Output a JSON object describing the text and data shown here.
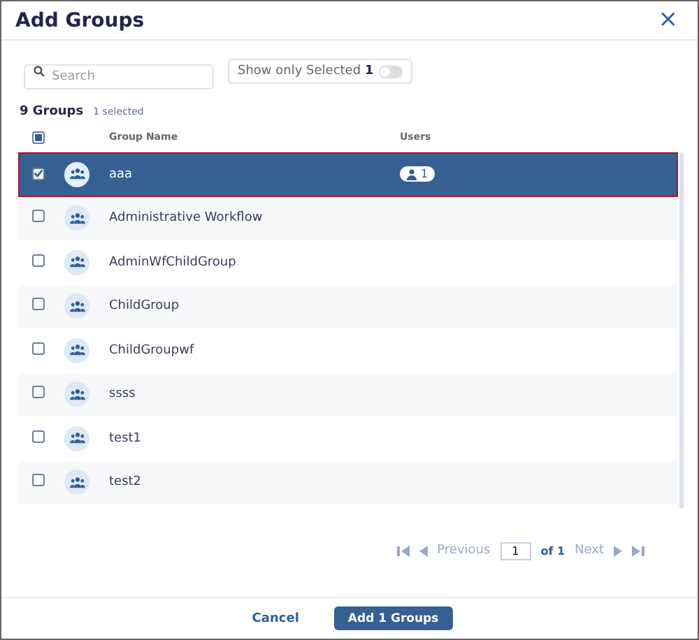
{
  "dialog": {
    "title": "Add Groups",
    "close": "×"
  },
  "search": {
    "placeholder": "Search"
  },
  "show_only_selected": {
    "label": "Show only Selected",
    "count": "1",
    "on": false
  },
  "summary": {
    "count": "9 Groups",
    "selected": "1 selected"
  },
  "table": {
    "select_all_indeterminate": true,
    "columns": [
      "Group Name",
      "Users"
    ],
    "rows": [
      {
        "name": "aaa",
        "selected": true,
        "users": "1"
      },
      {
        "name": "Administrative Workflow",
        "selected": false
      },
      {
        "name": "AdminWfChildGroup",
        "selected": false
      },
      {
        "name": "ChildGroup",
        "selected": false
      },
      {
        "name": "ChildGroupwf",
        "selected": false
      },
      {
        "name": "ssss",
        "selected": false
      },
      {
        "name": "test1",
        "selected": false
      },
      {
        "name": "test2",
        "selected": false
      }
    ]
  },
  "pagination": {
    "previous": {
      "label": "Previous",
      "disabled": true
    },
    "page": "1",
    "of": "of 1",
    "next": {
      "label": "Next",
      "disabled": true
    }
  },
  "buttons": {
    "cancel": "Cancel",
    "confirm": "Add 1 Groups"
  }
}
